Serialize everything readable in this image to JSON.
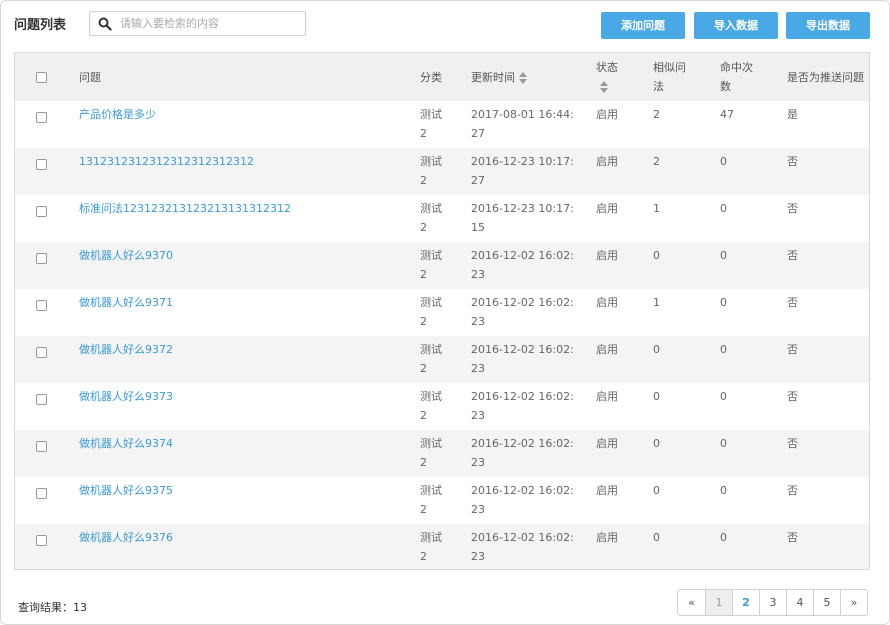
{
  "header": {
    "title": "问题列表",
    "search_placeholder": "请输入要检索的内容",
    "buttons": {
      "add": "添加问题",
      "import": "导入数据",
      "export": "导出数据"
    }
  },
  "table": {
    "columns": {
      "question": "问题",
      "category": "分类",
      "updated": "更新时间",
      "status": "状态",
      "similar": "相似问法",
      "hits": "命中次数",
      "push": "是否为推送问题"
    },
    "rows": [
      {
        "question": "产品价格是多少",
        "category": "测试2",
        "updated": "2017-08-01 16:44:27",
        "status": "启用",
        "similar": "2",
        "hits": "47",
        "push": "是"
      },
      {
        "question": "1312312312312312312312312",
        "category": "测试2",
        "updated": "2016-12-23 10:17:27",
        "status": "启用",
        "similar": "2",
        "hits": "0",
        "push": "否"
      },
      {
        "question": "标准问法123123213123213131312312",
        "category": "测试2",
        "updated": "2016-12-23 10:17:15",
        "status": "启用",
        "similar": "1",
        "hits": "0",
        "push": "否"
      },
      {
        "question": "做机器人好么9370",
        "category": "测试2",
        "updated": "2016-12-02 16:02:23",
        "status": "启用",
        "similar": "0",
        "hits": "0",
        "push": "否"
      },
      {
        "question": "做机器人好么9371",
        "category": "测试2",
        "updated": "2016-12-02 16:02:23",
        "status": "启用",
        "similar": "1",
        "hits": "0",
        "push": "否"
      },
      {
        "question": "做机器人好么9372",
        "category": "测试2",
        "updated": "2016-12-02 16:02:23",
        "status": "启用",
        "similar": "0",
        "hits": "0",
        "push": "否"
      },
      {
        "question": "做机器人好么9373",
        "category": "测试2",
        "updated": "2016-12-02 16:02:23",
        "status": "启用",
        "similar": "0",
        "hits": "0",
        "push": "否"
      },
      {
        "question": "做机器人好么9374",
        "category": "测试2",
        "updated": "2016-12-02 16:02:23",
        "status": "启用",
        "similar": "0",
        "hits": "0",
        "push": "否"
      },
      {
        "question": "做机器人好么9375",
        "category": "测试2",
        "updated": "2016-12-02 16:02:23",
        "status": "启用",
        "similar": "0",
        "hits": "0",
        "push": "否"
      },
      {
        "question": "做机器人好么9376",
        "category": "测试2",
        "updated": "2016-12-02 16:02:23",
        "status": "启用",
        "similar": "0",
        "hits": "0",
        "push": "否"
      }
    ]
  },
  "footer": {
    "result_label": "查询结果：",
    "result_count": "13"
  },
  "pagination": {
    "prev": "«",
    "pages": [
      "1",
      "2",
      "3",
      "4",
      "5"
    ],
    "current": "1",
    "next": "»"
  },
  "colors": {
    "accent": "#4aa8e6",
    "link": "#3a9ad9",
    "header_bg": "#f0f0f0",
    "stripe_bg": "#f4f4f4"
  },
  "icons": {
    "search": "search-icon",
    "sort": "sort-icon",
    "checkbox": "checkbox"
  }
}
